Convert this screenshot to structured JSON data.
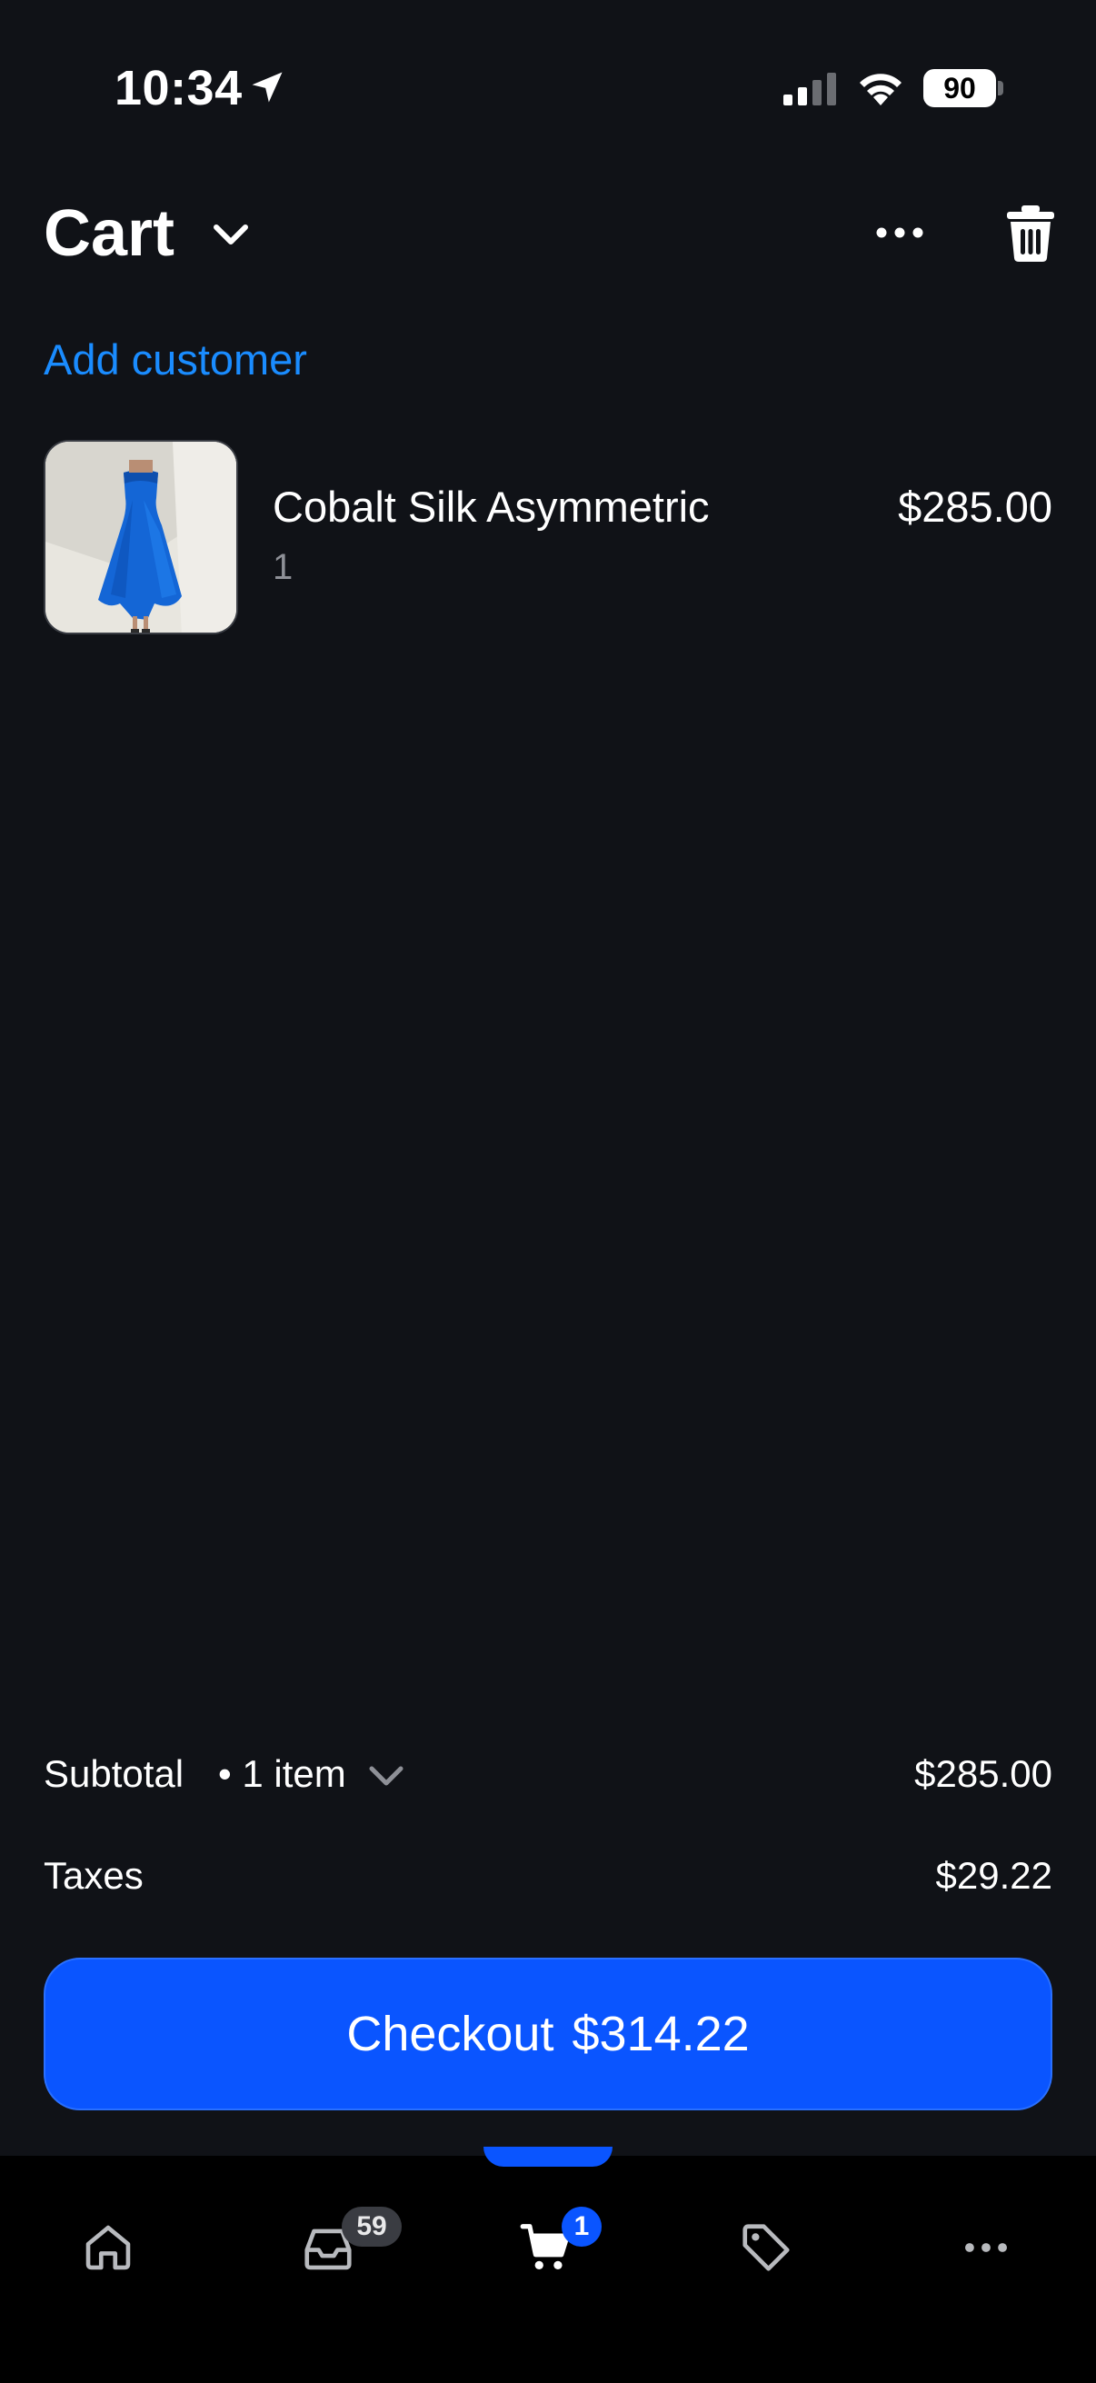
{
  "status_bar": {
    "time": "10:34",
    "battery": "90"
  },
  "header": {
    "title": "Cart",
    "add_customer_label": "Add customer"
  },
  "cart": {
    "items": [
      {
        "name": "Cobalt Silk Asymmetric",
        "quantity": "1",
        "price": "$285.00",
        "image_icon": "blue-dress-product-image"
      }
    ]
  },
  "summary": {
    "subtotal_label": "Subtotal",
    "item_count": "• 1 item",
    "subtotal_value": "$285.00",
    "taxes_label": "Taxes",
    "taxes_value": "$29.22",
    "checkout_label": "Checkout",
    "checkout_total": "$314.22"
  },
  "tab_bar": {
    "tabs": [
      {
        "icon": "home-icon"
      },
      {
        "icon": "inbox-icon",
        "badge": "59"
      },
      {
        "icon": "cart-icon",
        "badge": "1",
        "active": true
      },
      {
        "icon": "tag-icon"
      },
      {
        "icon": "more-icon"
      }
    ]
  },
  "colors": {
    "background": "#101217",
    "accent_link": "#1a8cff",
    "primary_button": "#0a55ff",
    "tab_bar": "#000000"
  }
}
